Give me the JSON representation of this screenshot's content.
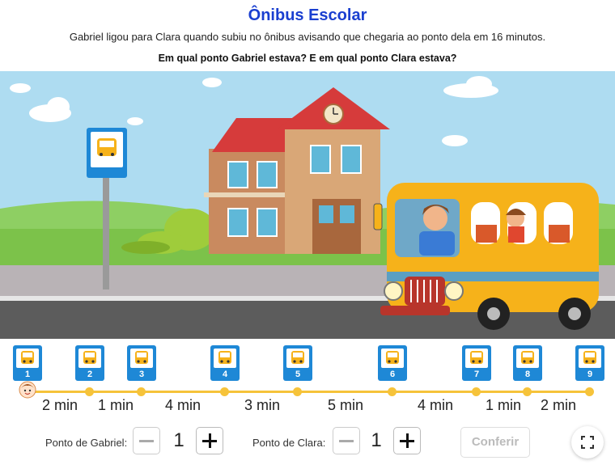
{
  "header": {
    "title": "Ônibus Escolar",
    "subtitle": "Gabriel ligou para Clara quando subiu no ônibus avisando que chegaria ao ponto dela em 16 minutos.",
    "question": "Em qual ponto Gabriel estava? E em qual ponto Clara estava?"
  },
  "colors": {
    "title": "#1a3fd0",
    "sky": "#aedcf1",
    "grass": "#7cc24a",
    "road": "#5c5c5c",
    "bus": "#f6b21a",
    "stop_sign": "#1e88d6",
    "track": "#f6c33a"
  },
  "stops": [
    {
      "number": "1"
    },
    {
      "number": "2"
    },
    {
      "number": "3"
    },
    {
      "number": "4"
    },
    {
      "number": "5"
    },
    {
      "number": "6"
    },
    {
      "number": "7"
    },
    {
      "number": "8"
    },
    {
      "number": "9"
    }
  ],
  "segments": [
    "2 min",
    "1 min",
    "4 min",
    "3 min",
    "5 min",
    "4 min",
    "1 min",
    "2 min"
  ],
  "controls": {
    "gabriel_label": "Ponto de Gabriel:",
    "gabriel_value": "1",
    "clara_label": "Ponto de Clara:",
    "clara_value": "1",
    "submit_label": "Conferir"
  },
  "icons": [
    "bus-icon",
    "minus-icon",
    "plus-icon",
    "fullscreen-icon",
    "gabriel-avatar-icon"
  ]
}
